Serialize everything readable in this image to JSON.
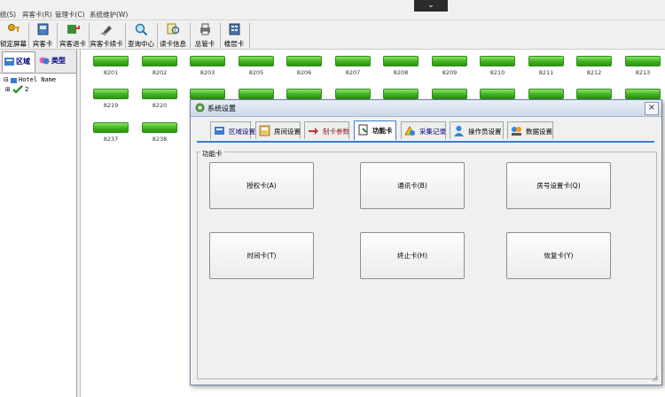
{
  "menu": [
    "统(S)",
    "宾客卡(R)",
    "管理卡(C)",
    "系统维护(W)"
  ],
  "dropdown_glyph": "⌄",
  "toolbar": [
    "锁定屏幕",
    "宾客卡",
    "宾客退卡",
    "宾客卡续卡",
    "查询中心",
    "读卡信息",
    "总管卡",
    "楼层卡"
  ],
  "left_tabs": [
    "区域",
    "类型"
  ],
  "tree": {
    "root": "Hotel Name",
    "child": "2"
  },
  "rooms": [
    {
      "num": "8201"
    },
    {
      "num": "8202"
    },
    {
      "num": "8203"
    },
    {
      "num": "8205"
    },
    {
      "num": "8206"
    },
    {
      "num": "8207"
    },
    {
      "num": "8208"
    },
    {
      "num": "8209"
    },
    {
      "num": "8210"
    },
    {
      "num": "8211"
    },
    {
      "num": "8212"
    },
    {
      "num": "8213"
    },
    {
      "num": "8219"
    },
    {
      "num": "8220"
    },
    {
      "num": "8237"
    },
    {
      "num": "8238"
    }
  ],
  "dialog": {
    "title": "系统设置",
    "close": "×",
    "tabs": [
      "区域设置",
      "房间设置",
      "制卡参数",
      "功能卡",
      "采集记录",
      "操作员设置",
      "数据设置"
    ],
    "group_title": "功能卡",
    "buttons": [
      "授权卡(A)",
      "通讯卡(B)",
      "房号设置卡(Q)",
      "时间卡(T)",
      "终止卡(H)",
      "恢复卡(Y)"
    ]
  }
}
